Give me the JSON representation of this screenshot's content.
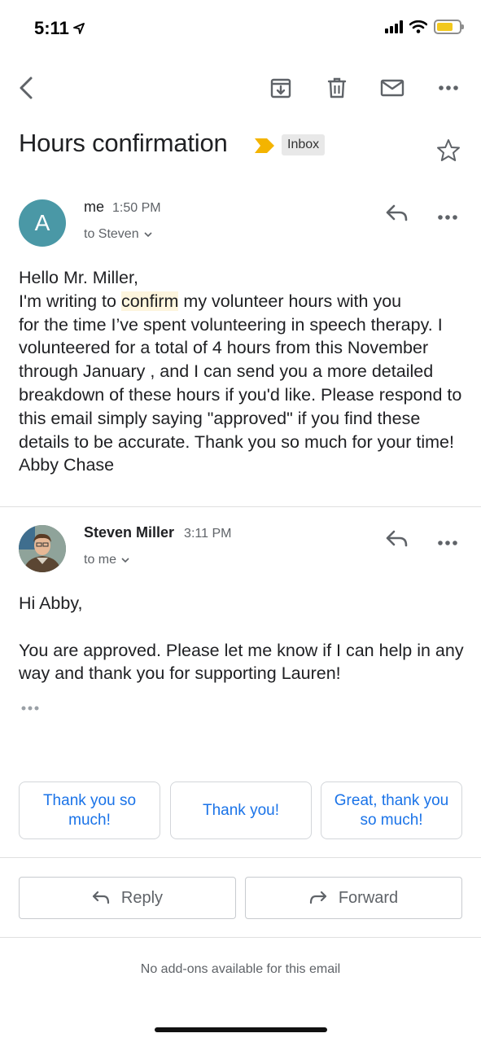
{
  "status_bar": {
    "time": "5:11"
  },
  "toolbar": {
    "back": "back-arrow-icon",
    "archive": "archive-icon",
    "delete": "trash-icon",
    "mark_unread": "mail-icon",
    "more": "more-horizontal-icon"
  },
  "subject": {
    "title": "Hours confirmation",
    "label": "Inbox",
    "label_color": "#f4b400"
  },
  "messages": [
    {
      "avatar_letter": "A",
      "avatar_color": "#4a98a6",
      "sender": "me",
      "time": "1:50 PM",
      "recipient": "to Steven",
      "body": {
        "greeting": "Hello Mr. Miller,",
        "line_pre": "I'm writing to ",
        "highlight": "confirm",
        "line_post": " my volunteer hours with you",
        "rest": "for the time I’ve spent volunteering in speech therapy. I volunteered for a total of 4 hours from this November through January , and I can send you a more detailed breakdown of these hours if you'd like. Please respond to this email simply saying \"approved\" if you find these details to be accurate. Thank you so much for your time!",
        "signature": "Abby Chase"
      }
    },
    {
      "sender": "Steven Miller",
      "time": "3:11 PM",
      "recipient": "to me",
      "body": {
        "greeting": "Hi Abby,",
        "text": "You are approved.  Please let me know if I can help in any way and thank you for supporting Lauren!"
      }
    }
  ],
  "smart_replies": [
    "Thank you so much!",
    "Thank you!",
    "Great, thank you so much!"
  ],
  "actions": {
    "reply": "Reply",
    "forward": "Forward"
  },
  "footer": {
    "addons": "No add-ons available for this email"
  }
}
